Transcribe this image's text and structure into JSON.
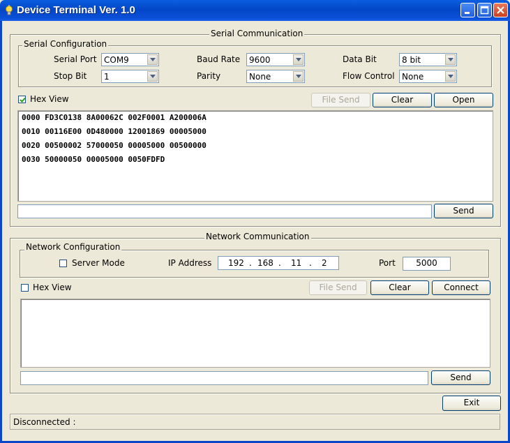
{
  "window": {
    "title": "Device Terminal Ver. 1.0"
  },
  "serial": {
    "legend": "Serial Communication",
    "config_legend": "Serial Configuration",
    "port_label": "Serial Port",
    "port_value": "COM9",
    "baud_label": "Baud Rate",
    "baud_value": "9600",
    "databit_label": "Data Bit",
    "databit_value": "8 bit",
    "stopbit_label": "Stop Bit",
    "stopbit_value": "1",
    "parity_label": "Parity",
    "parity_value": "None",
    "flow_label": "Flow Control",
    "flow_value": "None",
    "hexview_label": "Hex View",
    "hexview_checked": true,
    "file_send": "File Send",
    "clear": "Clear",
    "open": "Open",
    "lines": [
      "0000 FD3C0138 8A00062C 002F0001 A200006A",
      "0010 00116E00 0D480000 12001869 00005000",
      "0020 00500002 57000050 00005000 00500000",
      "0030 50000050 00005000 0050FDFD"
    ],
    "input_value": "",
    "send": "Send"
  },
  "network": {
    "legend": "Network Communication",
    "config_legend": "Network Configuration",
    "server_mode_label": "Server Mode",
    "server_mode_checked": false,
    "ip_label": "IP Address",
    "ip": [
      "192",
      "168",
      "11",
      "2"
    ],
    "ip_dot": ".",
    "port_label": "Port",
    "port_value": "5000",
    "hexview_label": "Hex View",
    "hexview_checked": false,
    "file_send": "File Send",
    "clear": "Clear",
    "connect": "Connect",
    "input_value": "",
    "send": "Send"
  },
  "exit": "Exit",
  "status": "Disconnected :",
  "colors": {
    "titlebar": "#0a4fd6",
    "face": "#ece9d8",
    "close": "#c8411f"
  }
}
